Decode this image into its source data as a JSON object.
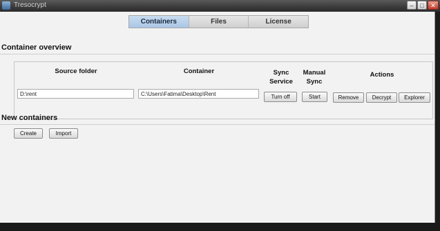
{
  "window": {
    "title": "Tresocrypt",
    "minimize_label": "–",
    "maximize_label": "□",
    "close_label": "✕"
  },
  "tabs": [
    {
      "label": "Containers",
      "active": true
    },
    {
      "label": "Files",
      "active": false
    },
    {
      "label": "License",
      "active": false
    }
  ],
  "overview": {
    "title": "Container overview",
    "headers": {
      "source": "Source folder",
      "container": "Container",
      "sync_service": "Sync\nService",
      "manual_sync": "Manual\nSync",
      "actions": "Actions"
    },
    "row": {
      "source_value": "D:\\rent",
      "container_value": "C:\\Users\\Fatima\\Desktop\\Rent",
      "sync_service_button": "Turn off",
      "manual_sync_button": "Start",
      "remove_button": "Remove",
      "decrypt_button": "Decrypt",
      "explorer_button": "Explorer"
    }
  },
  "new_containers": {
    "title": "New containers",
    "create_button": "Create",
    "import_button": "Import"
  },
  "colors": {
    "panel_bg": "#f2f2f2",
    "active_tab": "#a9c6e6",
    "chrome": "#3a3a3a"
  }
}
